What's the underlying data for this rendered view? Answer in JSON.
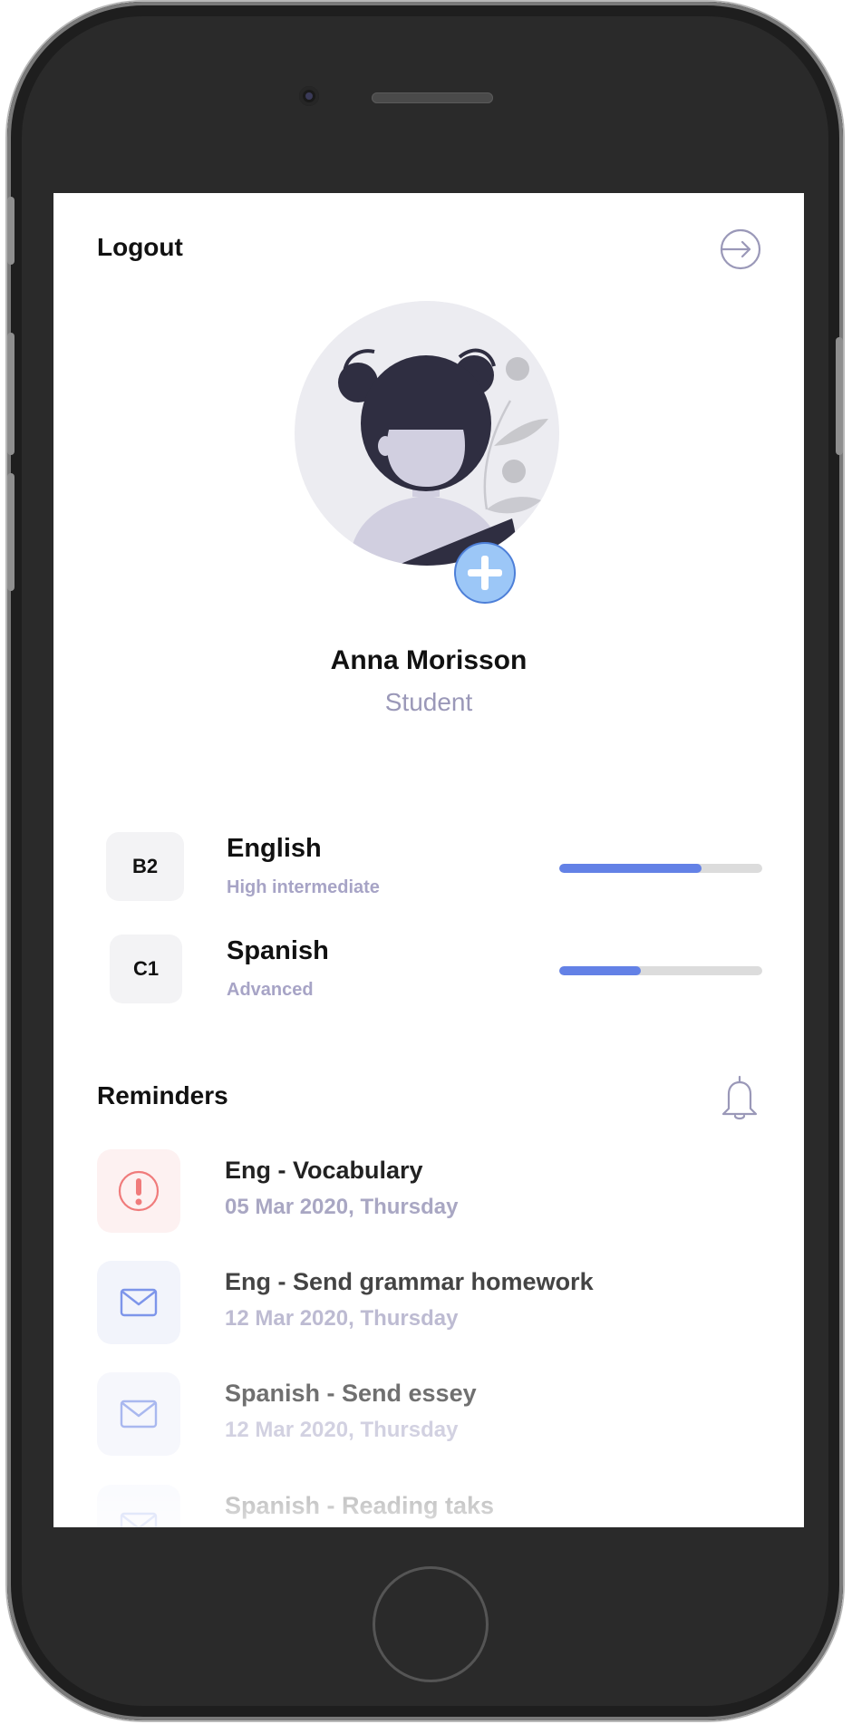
{
  "topbar": {
    "logout_label": "Logout",
    "logout_icon": "logout-arrow-icon"
  },
  "profile": {
    "name": "Anna Morisson",
    "role": "Student",
    "add_photo_icon": "plus-icon",
    "colors": {
      "add_button": "#9cc7f7",
      "avatar_bg": "#ececf1",
      "hair": "#2f2e41"
    }
  },
  "languages": [
    {
      "badge": "B2",
      "name": "English",
      "level": "High intermediate",
      "progress": 0.7
    },
    {
      "badge": "C1",
      "name": "Spanish",
      "level": "Advanced",
      "progress": 0.4
    }
  ],
  "reminders": {
    "title": "Reminders",
    "icon": "bell-icon",
    "items": [
      {
        "title": "Eng - Vocabulary",
        "date": "05 Mar 2020, Thursday",
        "icon": "alert-icon"
      },
      {
        "title": "Eng - Send grammar homework",
        "date": "12 Mar 2020, Thursday",
        "icon": "mail-icon"
      },
      {
        "title": "Spanish - Send essey",
        "date": "12 Mar 2020, Thursday",
        "icon": "mail-icon"
      },
      {
        "title": "Spanish - Reading taks",
        "date": "",
        "icon": "mail-icon"
      }
    ]
  },
  "colors": {
    "accent": "#6381e6",
    "muted_text": "#9a98b8",
    "alert": "#f07b7b",
    "alert_bg": "#fdf1f1",
    "mail": "#7d95ea",
    "mail_bg": "#f2f4fb"
  }
}
